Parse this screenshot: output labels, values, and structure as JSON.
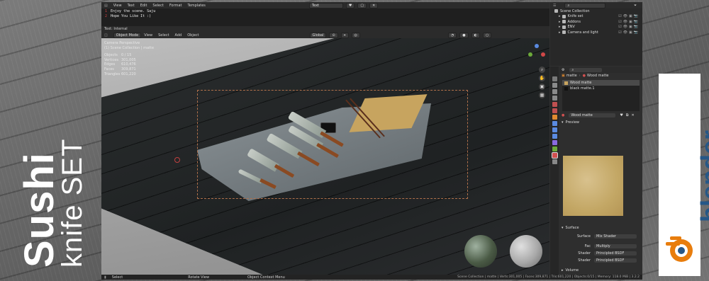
{
  "overlay": {
    "title": "Sushi",
    "subtitle": "knife SET",
    "brand": "blender",
    "brand_color": "#265787",
    "accent": "#e87d0d"
  },
  "text_editor": {
    "menu": [
      "View",
      "Text",
      "Edit",
      "Select",
      "Format",
      "Templates"
    ],
    "file_name": "Text",
    "lines": [
      {
        "num": "1",
        "text": "Enjoy the scene.  Saju"
      },
      {
        "num": "2",
        "text": "Hope You Like It :)"
      }
    ],
    "footer": "Text: Internal"
  },
  "viewport": {
    "mode": "Object Mode",
    "menu": [
      "View",
      "Select",
      "Add",
      "Object"
    ],
    "orientation": "Global",
    "stats": {
      "title": "Camera Perspective",
      "collection": "(1) Scene Collection | matte",
      "rows": [
        {
          "label": "Objects",
          "value": "0 / 15"
        },
        {
          "label": "Vertices",
          "value": "301,005"
        },
        {
          "label": "Edges",
          "value": "610,476"
        },
        {
          "label": "Faces",
          "value": "309,871"
        },
        {
          "label": "Triangles",
          "value": "601,220"
        }
      ]
    }
  },
  "statusbar": {
    "left": "Select",
    "mid": "Rotate View",
    "mid2": "Object Context Menu",
    "right": "Scene Collection | matte | Verts:301,005 | Faces:309,871 | Tris:601,220 | Objects:0/15 | Memory: 118.0 MiB | 3.2.2"
  },
  "outliner": {
    "root": "Scene Collection",
    "items": [
      "Knife set",
      "Addons",
      "ENV",
      "Camera and light"
    ]
  },
  "properties": {
    "object": "matte",
    "material_slot": "Wood matte",
    "materials": [
      "Wood matte",
      "black matte.1"
    ],
    "material_name": "Wood matte",
    "preview_label": "Preview",
    "surface_label": "Surface",
    "surface_rows": [
      {
        "label": "Surface",
        "value": "Mix Shader"
      },
      {
        "label": "Fac",
        "value": "Multiply"
      },
      {
        "label": "Shader",
        "value": "Principled BSDF"
      },
      {
        "label": "Shader",
        "value": "Principled BSDF"
      }
    ],
    "volume_label": "Volume"
  }
}
